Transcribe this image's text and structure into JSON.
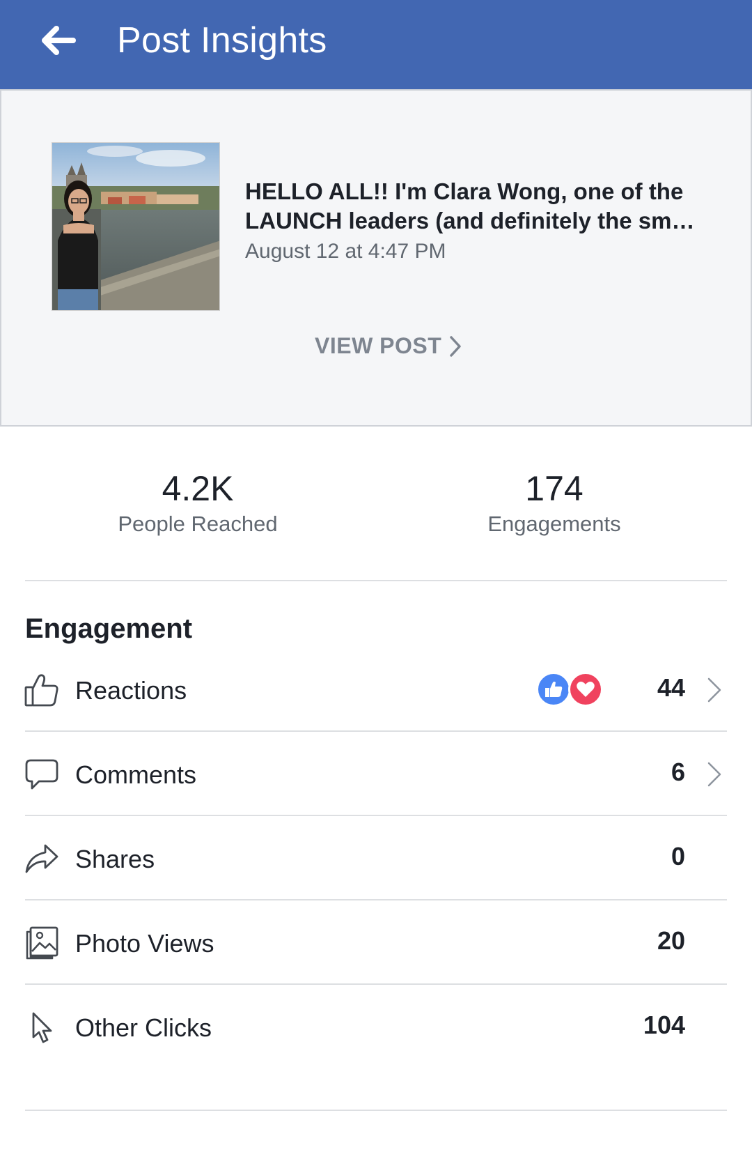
{
  "header": {
    "title": "Post Insights",
    "back_icon": "arrow-left-icon",
    "background": "#4267b2"
  },
  "post": {
    "message": "HELLO ALL!! I'm Clara Wong, one of the LAUNCH leaders (and definitely the sm…",
    "date": "August 12 at 4:47 PM",
    "view_post_label": "VIEW POST",
    "thumbnail": "post-photo-thumbnail"
  },
  "stats": {
    "reached": {
      "value": "4.2K",
      "label": "People Reached"
    },
    "engagements": {
      "value": "174",
      "label": "Engagements"
    }
  },
  "engagement": {
    "title": "Engagement",
    "rows": [
      {
        "label": "Reactions",
        "value": "44",
        "icon": "thumbs-up-icon",
        "has_chevron": true
      },
      {
        "label": "Comments",
        "value": "6",
        "icon": "comment-bubble-icon",
        "has_chevron": true
      },
      {
        "label": "Shares",
        "value": "0",
        "icon": "share-arrow-icon",
        "has_chevron": false
      },
      {
        "label": "Photo Views",
        "value": "20",
        "icon": "photo-icon",
        "has_chevron": false
      },
      {
        "label": "Other Clicks",
        "value": "104",
        "icon": "cursor-icon",
        "has_chevron": false
      }
    ]
  },
  "colors": {
    "brand_blue": "#4267b2",
    "like_blue": "#4a86f6",
    "love_red": "#f0425e",
    "secondary_text": "#606770"
  }
}
